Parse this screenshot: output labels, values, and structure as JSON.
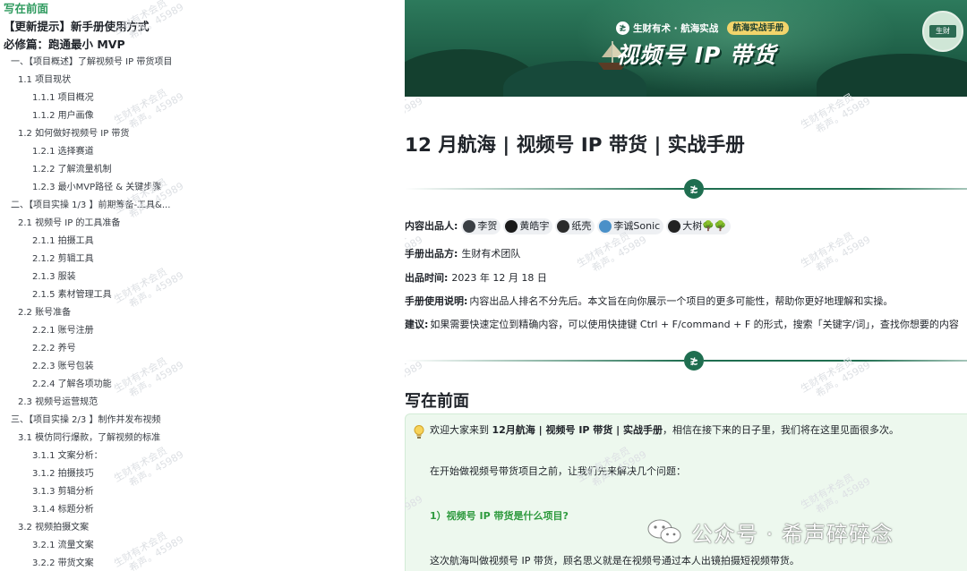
{
  "toc": {
    "items": [
      {
        "label": "写在前面",
        "level": 0,
        "active": true
      },
      {
        "label": "【更新提示】新手册使用方式",
        "level": 0,
        "active": false
      },
      {
        "label": "必修篇：跑通最小 MVP",
        "level": 0,
        "active": false
      },
      {
        "label": "一、【项目概述】了解视频号 IP 带货项目",
        "level": 1,
        "active": false
      },
      {
        "label": "1.1 项目现状",
        "level": 2,
        "active": false
      },
      {
        "label": "1.1.1 项目概况",
        "level": 3,
        "active": false
      },
      {
        "label": "1.1.2 用户画像",
        "level": 3,
        "active": false
      },
      {
        "label": "1.2 如何做好视频号 IP 带货",
        "level": 2,
        "active": false
      },
      {
        "label": "1.2.1 选择赛道",
        "level": 3,
        "active": false
      },
      {
        "label": "1.2.2 了解流量机制",
        "level": 3,
        "active": false
      },
      {
        "label": "1.2.3 最小MVP路径 & 关键步骤",
        "level": 3,
        "active": false
      },
      {
        "label": "二、【项目实操 1/3 】前期筹备-工具&...",
        "level": 1,
        "active": false
      },
      {
        "label": "2.1 视频号 IP 的工具准备",
        "level": 2,
        "active": false
      },
      {
        "label": "2.1.1 拍摄工具",
        "level": 3,
        "active": false
      },
      {
        "label": "2.1.2 剪辑工具",
        "level": 3,
        "active": false
      },
      {
        "label": "2.1.3 服装",
        "level": 3,
        "active": false
      },
      {
        "label": "2.1.5 素材管理工具",
        "level": 3,
        "active": false
      },
      {
        "label": "2.2 账号准备",
        "level": 2,
        "active": false
      },
      {
        "label": "2.2.1 账号注册",
        "level": 3,
        "active": false
      },
      {
        "label": "2.2.2 养号",
        "level": 3,
        "active": false
      },
      {
        "label": "2.2.3 账号包装",
        "level": 3,
        "active": false
      },
      {
        "label": "2.2.4 了解各项功能",
        "level": 3,
        "active": false
      },
      {
        "label": "2.3 视频号运营规范",
        "level": 2,
        "active": false
      },
      {
        "label": "三、【项目实操 2/3 】制作并发布视频",
        "level": 1,
        "active": false
      },
      {
        "label": "3.1 模仿同行爆款，了解视频的标准",
        "level": 2,
        "active": false
      },
      {
        "label": "3.1.1 文案分析：",
        "level": 3,
        "active": false
      },
      {
        "label": "3.1.2 拍摄技巧",
        "level": 3,
        "active": false
      },
      {
        "label": "3.1.3 剪辑分析",
        "level": 3,
        "active": false
      },
      {
        "label": "3.1.4 标题分析",
        "level": 3,
        "active": false
      },
      {
        "label": "3.2 视频拍摄文案",
        "level": 2,
        "active": false
      },
      {
        "label": "3.2.1 流量文案",
        "level": 3,
        "active": false
      },
      {
        "label": "3.2.2 带货文案",
        "level": 3,
        "active": false
      }
    ]
  },
  "watermark": {
    "line1": "生财有术会员",
    "line2": "希声。45989"
  },
  "banner": {
    "brand": "生财有术 · 航海实战",
    "tag": "航海实战手册",
    "title": "视频号 IP 带货",
    "badge": "生财"
  },
  "doc": {
    "title": "12 月航海 | 视频号 IP 带货 | 实战手册",
    "divider_glyph": "≵",
    "contributors_label": "内容出品人:",
    "contributors": [
      {
        "name": "李贺",
        "avatar_color": "#3a3f44"
      },
      {
        "name": "黄皓宇",
        "avatar_color": "#1a1a1a"
      },
      {
        "name": "纸壳",
        "avatar_color": "#2b2b2b"
      },
      {
        "name": "李诚Sonic",
        "avatar_color": "#4a90c8"
      },
      {
        "name": "大树",
        "avatar_color": "#222222",
        "suffix": "🌳🌳"
      }
    ],
    "producer_label": "手册出品方:",
    "producer": "生财有术团队",
    "date_label": "出品时间:",
    "date": "2023 年 12 月 18 日",
    "usage_label": "手册使用说明:",
    "usage": "内容出品人排名不分先后。本文旨在向你展示一个项目的更多可能性，帮助你更好地理解和实操。",
    "advice_label": "建议:",
    "advice": "如果需要快速定位到精确内容，可以使用快捷键 Ctrl + F/command + F 的形式，搜索「关键字/词」，查找你想要的内容",
    "section_title": "写在前面",
    "callout": {
      "intro_pre": "欢迎大家来到 ",
      "intro_bold": "12月航海 | 视频号 IP 带货 | 实战手册",
      "intro_post": "，相信在接下来的日子里，我们将在这里见面很多次。",
      "line2": "在开始做视频号带货项目之前，让我们先来解决几个问题：",
      "q1": "1）视频号 IP 带货是什么项目?",
      "line4": "这次航海叫做视频号 IP 带货，顾名思义就是在视频号通过本人出镜拍摄短视频带货。"
    }
  },
  "overlay": {
    "wechat_text": "公众号 · 希声碎碎念"
  }
}
